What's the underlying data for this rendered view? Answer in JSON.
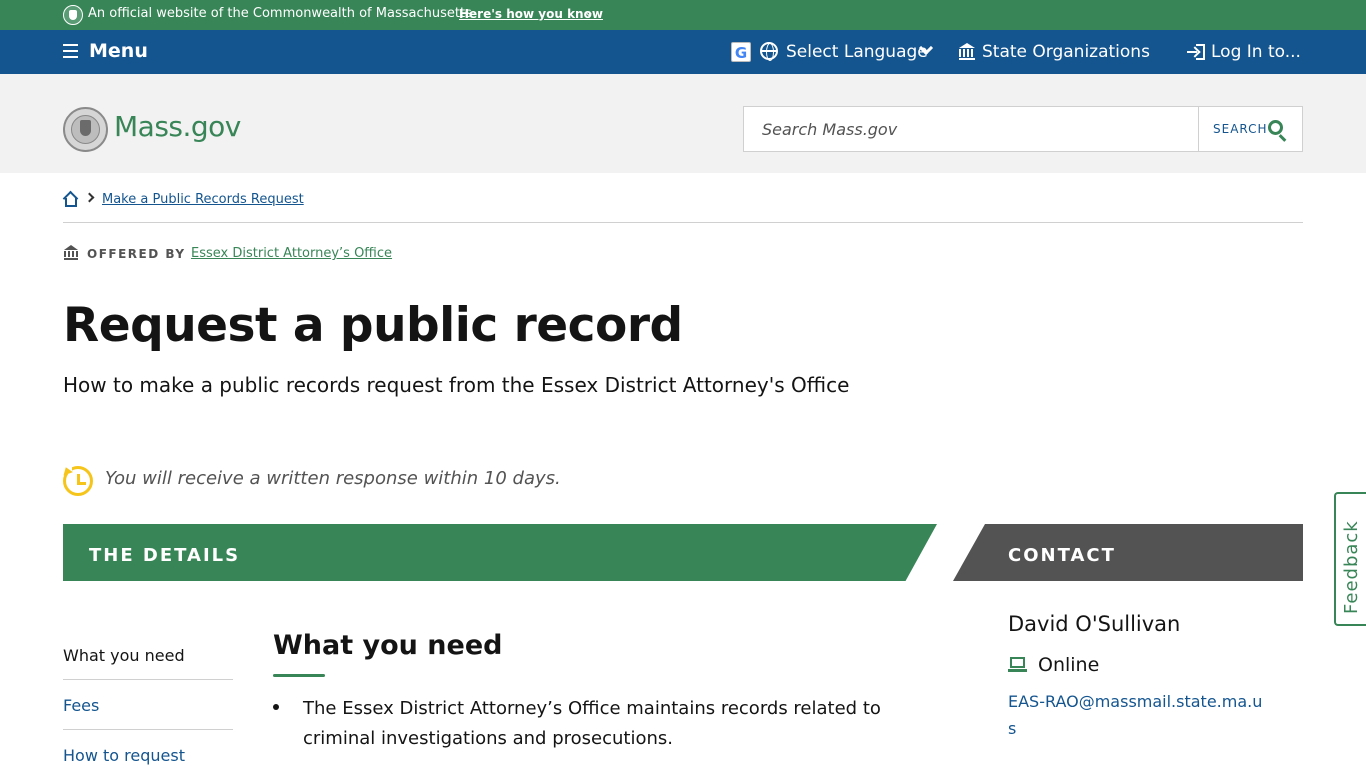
{
  "banner": {
    "text": "An official website of the Commonwealth of Massachusetts",
    "how_link": "Here's how you know",
    "brand_color": "#388557"
  },
  "nav": {
    "menu_label": "Menu",
    "language_label": "Select Language",
    "organizations_label": "State Organizations",
    "login_label": "Log In to...",
    "bg_color": "#14558f"
  },
  "header": {
    "logo_text": "Mass.gov",
    "search_placeholder": "Search Mass.gov",
    "search_button": "SEARCH"
  },
  "breadcrumb": {
    "link": "Make a Public Records Request"
  },
  "offered_by": {
    "label": "OFFERED BY",
    "org": "Essex District Attorney’s Office"
  },
  "page": {
    "title": "Request a public record",
    "subtitle": "How to make a public records request from the Essex District Attorney's Office",
    "response_time": "You will receive a written response within 10 days."
  },
  "sections": {
    "details": "THE DETAILS",
    "contact": "CONTACT"
  },
  "side_nav": [
    "What you need",
    "Fees",
    "How to request"
  ],
  "content": {
    "heading": "What you need",
    "paragraphs": [
      "The Essex District Attorney’s Office maintains records related to criminal investigations and prosecutions."
    ]
  },
  "contact": {
    "name": "David O'Sullivan",
    "method": "Online",
    "email": "EAS-RAO@massmail.state.ma.us"
  },
  "feedback": {
    "label": "Feedback"
  }
}
